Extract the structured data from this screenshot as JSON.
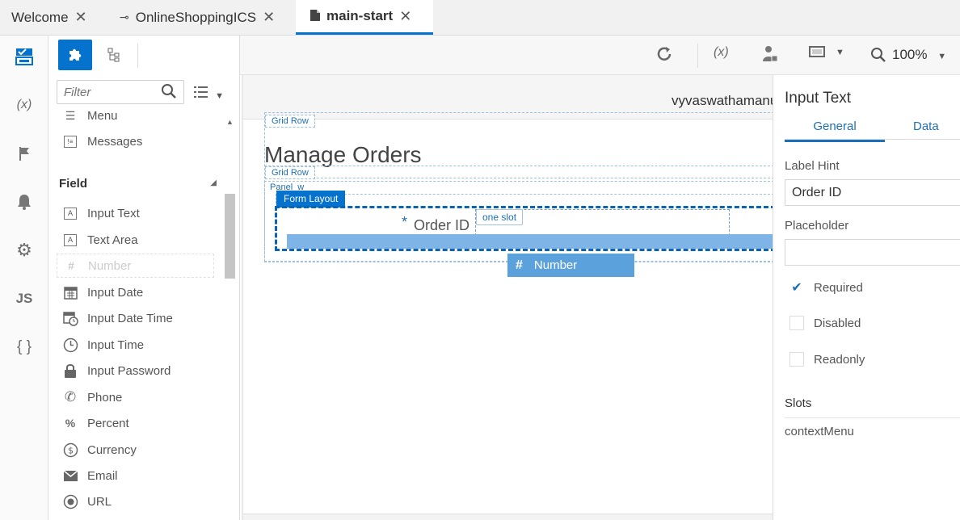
{
  "tabs": [
    {
      "label": "Welcome",
      "icon": "none"
    },
    {
      "label": "OnlineShoppingICS",
      "icon": "service-connection-icon"
    },
    {
      "label": "main-start",
      "icon": "page-icon"
    }
  ],
  "rail": {
    "variables_label": "(x)",
    "js_label": "JS",
    "json_label": "{ }"
  },
  "palette": {
    "filter_placeholder": "Filter",
    "items_top": [
      {
        "label": "Menu",
        "icon": "menu-icon"
      },
      {
        "label": "Messages",
        "icon": "messages-icon"
      }
    ],
    "section": "Field",
    "field_items": [
      {
        "label": "Input Text",
        "icon": "input-text-icon",
        "glyph": "A"
      },
      {
        "label": "Text Area",
        "icon": "text-area-icon",
        "glyph": "A"
      },
      {
        "label": "Number",
        "icon": "number-icon",
        "glyph": "#"
      },
      {
        "label": "Input Date",
        "icon": "calendar-icon",
        "glyph": "▦"
      },
      {
        "label": "Input Date Time",
        "icon": "calendar-clock-icon",
        "glyph": "▦"
      },
      {
        "label": "Input Time",
        "icon": "clock-icon",
        "glyph": "◷"
      },
      {
        "label": "Input Password",
        "icon": "lock-icon",
        "glyph": "🔒"
      },
      {
        "label": "Phone",
        "icon": "phone-icon",
        "glyph": "✆"
      },
      {
        "label": "Percent",
        "icon": "percent-icon",
        "glyph": "%"
      },
      {
        "label": "Currency",
        "icon": "currency-icon",
        "glyph": "$"
      },
      {
        "label": "Email",
        "icon": "email-icon",
        "glyph": "✉"
      },
      {
        "label": "URL",
        "icon": "url-icon",
        "glyph": "◉"
      }
    ]
  },
  "toolbar": {
    "variables_label": "(x)",
    "zoom": "100%"
  },
  "canvas": {
    "user": "vyvaswathamanu",
    "grid_row_1": "Grid Row",
    "page_title": "Manage Orders",
    "grid_row_2": "Grid Row",
    "panel_tag": "Panel",
    "panel_suffix": "w",
    "form_layout": "Form Layout",
    "required_mark": "*",
    "order_label": "Order ID",
    "slot_tag": "one slot",
    "drag_label": "Number",
    "drag_glyph": "#"
  },
  "props": {
    "title": "Input Text",
    "tabs": [
      "General",
      "Data"
    ],
    "label_hint_label": "Label Hint",
    "label_hint_value": "Order ID",
    "placeholder_label": "Placeholder",
    "placeholder_value": "",
    "required_label": "Required",
    "required_checked": true,
    "disabled_label": "Disabled",
    "disabled_checked": false,
    "readonly_label": "Readonly",
    "readonly_checked": false,
    "slots_label": "Slots",
    "slot_item": "contextMenu"
  },
  "colors": {
    "accent": "#0572ce",
    "drop_bar": "#7fb5e6",
    "drag_item": "#5ba2dc"
  }
}
